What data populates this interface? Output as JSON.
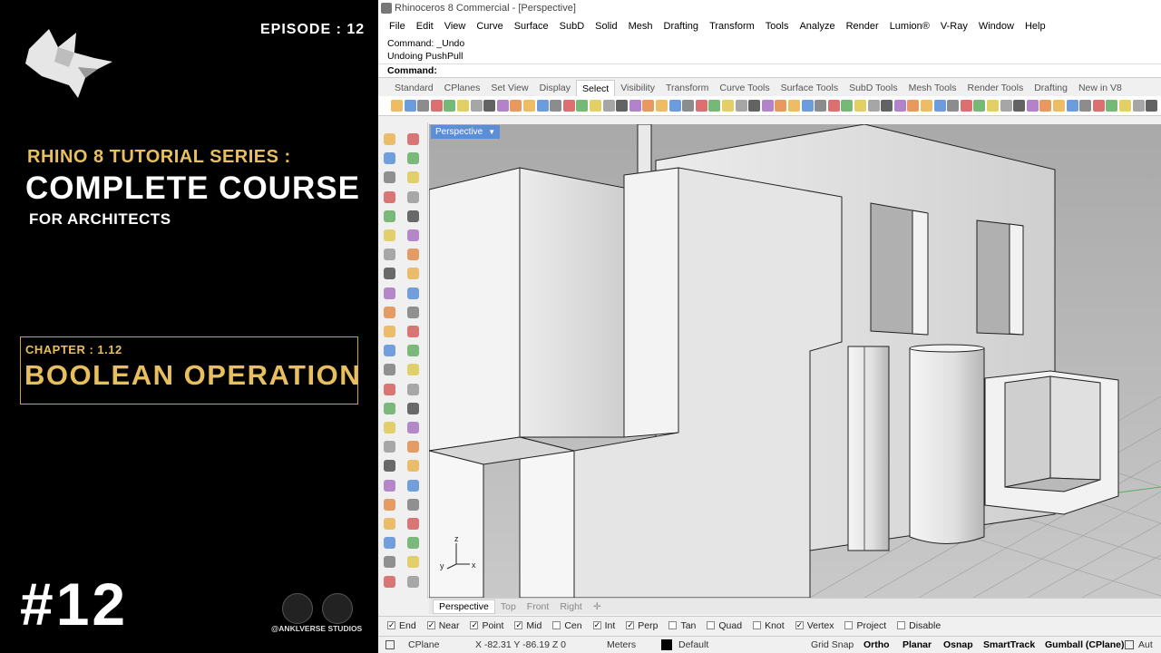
{
  "banner": {
    "episode": "EPISODE : 12",
    "series": "RHINO 8 TUTORIAL SERIES :",
    "course": "COMPLETE COURSE",
    "for": "FOR ARCHITECTS",
    "chapter": "CHAPTER : 1.12",
    "topic": "BOOLEAN OPERATION",
    "number": "#12",
    "studio": "@ANKLVERSE STUDIOS",
    "accent": "#e8bf5e"
  },
  "app": {
    "title": "Rhinoceros 8 Commercial - [Perspective]",
    "menu": [
      "File",
      "Edit",
      "View",
      "Curve",
      "Surface",
      "SubD",
      "Solid",
      "Mesh",
      "Drafting",
      "Transform",
      "Tools",
      "Analyze",
      "Render",
      "Lumion®",
      "V-Ray",
      "Window",
      "Help"
    ],
    "command_history": [
      "Command: _Undo",
      "Undoing PushPull"
    ],
    "command_prompt": "Command:",
    "toolbar_tabs": [
      "Standard",
      "CPlanes",
      "Set View",
      "Display",
      "Select",
      "Visibility",
      "Transform",
      "Curve Tools",
      "Surface Tools",
      "SubD Tools",
      "Mesh Tools",
      "Render Tools",
      "Drafting",
      "New in V8"
    ],
    "active_toolbar_tab": "Select",
    "viewport_label": "Perspective",
    "viewport_tabs": [
      "Perspective",
      "Top",
      "Front",
      "Right"
    ],
    "osnaps": [
      {
        "label": "End",
        "checked": true
      },
      {
        "label": "Near",
        "checked": true
      },
      {
        "label": "Point",
        "checked": true
      },
      {
        "label": "Mid",
        "checked": true
      },
      {
        "label": "Cen",
        "checked": false
      },
      {
        "label": "Int",
        "checked": true
      },
      {
        "label": "Perp",
        "checked": true
      },
      {
        "label": "Tan",
        "checked": false
      },
      {
        "label": "Quad",
        "checked": false
      },
      {
        "label": "Knot",
        "checked": false
      },
      {
        "label": "Vertex",
        "checked": true
      },
      {
        "label": "Project",
        "checked": false
      },
      {
        "label": "Disable",
        "checked": false
      }
    ],
    "status": {
      "cplane": "CPlane",
      "coords": "X -82.31 Y -86.19 Z 0",
      "units": "Meters",
      "layer": "Default",
      "grid_snap": "Grid Snap",
      "ortho": "Ortho",
      "planar": "Planar",
      "osnap": "Osnap",
      "smarttrack": "SmartTrack",
      "gumball": "Gumball (CPlane)",
      "auto": "Aut"
    },
    "axis": {
      "x": "x",
      "y": "y",
      "z": "z"
    }
  }
}
